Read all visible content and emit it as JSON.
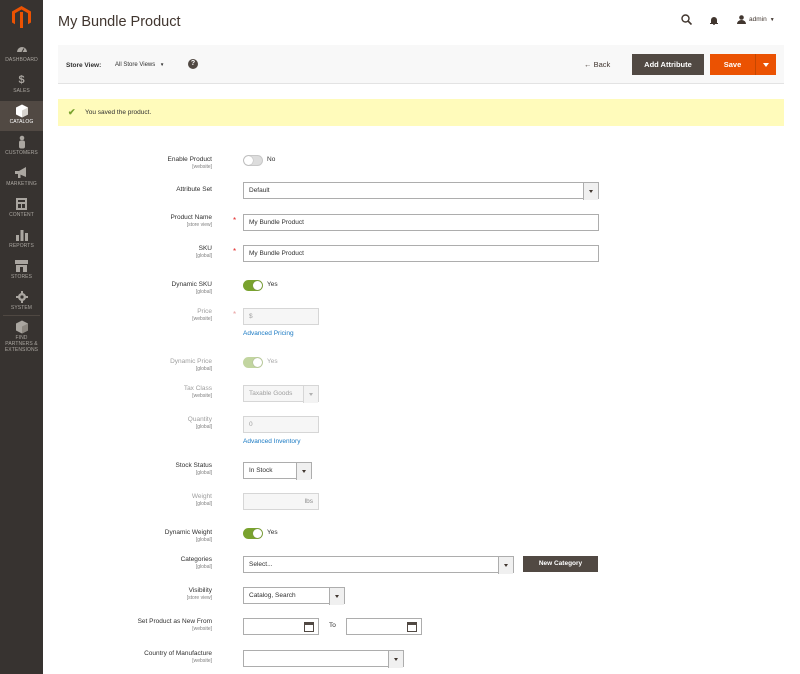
{
  "sidebar": {
    "items": [
      {
        "label": "DASHBOARD",
        "icon": "dashboard-icon"
      },
      {
        "label": "SALES",
        "icon": "dollar-icon"
      },
      {
        "label": "CATALOG",
        "icon": "box-icon"
      },
      {
        "label": "CUSTOMERS",
        "icon": "person-icon"
      },
      {
        "label": "MARKETING",
        "icon": "megaphone-icon"
      },
      {
        "label": "CONTENT",
        "icon": "layout-icon"
      },
      {
        "label": "REPORTS",
        "icon": "bar-chart-icon"
      },
      {
        "label": "STORES",
        "icon": "store-icon"
      },
      {
        "label": "SYSTEM",
        "icon": "gear-icon"
      },
      {
        "label": "FIND PARTNERS & EXTENSIONS",
        "icon": "cube-icon"
      }
    ],
    "active": "CATALOG"
  },
  "header": {
    "title": "My Bundle Product",
    "user": "admin"
  },
  "toolbar": {
    "store_view_label": "Store View:",
    "store_view_value": "All Store Views",
    "back_label": "Back",
    "add_attribute_label": "Add Attribute",
    "save_label": "Save"
  },
  "message": {
    "text": "You saved the product."
  },
  "form": {
    "enable_product": {
      "label": "Enable Product",
      "scope": "[website]",
      "value": "No"
    },
    "attribute_set": {
      "label": "Attribute Set",
      "value": "Default"
    },
    "product_name": {
      "label": "Product Name",
      "scope": "[store view]",
      "value": "My Bundle Product"
    },
    "sku": {
      "label": "SKU",
      "scope": "[global]",
      "value": "My Bundle Product"
    },
    "dynamic_sku": {
      "label": "Dynamic SKU",
      "scope": "[global]",
      "value": "Yes"
    },
    "price": {
      "label": "Price",
      "scope": "[website]",
      "currency": "$",
      "link": "Advanced Pricing"
    },
    "dynamic_price": {
      "label": "Dynamic Price",
      "scope": "[global]",
      "value": "Yes"
    },
    "tax_class": {
      "label": "Tax Class",
      "scope": "[website]",
      "value": "Taxable Goods"
    },
    "quantity": {
      "label": "Quantity",
      "scope": "[global]",
      "value": "0",
      "link": "Advanced Inventory"
    },
    "stock_status": {
      "label": "Stock Status",
      "scope": "[global]",
      "value": "In Stock"
    },
    "weight": {
      "label": "Weight",
      "scope": "[global]",
      "unit": "lbs"
    },
    "dynamic_weight": {
      "label": "Dynamic Weight",
      "scope": "[global]",
      "value": "Yes"
    },
    "categories": {
      "label": "Categories",
      "scope": "[global]",
      "value": "Select...",
      "button": "New Category"
    },
    "visibility": {
      "label": "Visibility",
      "scope": "[store view]",
      "value": "Catalog, Search"
    },
    "new_from": {
      "label": "Set Product as New From",
      "scope": "[website]",
      "to_label": "To"
    },
    "country": {
      "label": "Country of Manufacture",
      "scope": "[website]",
      "value": ""
    }
  }
}
